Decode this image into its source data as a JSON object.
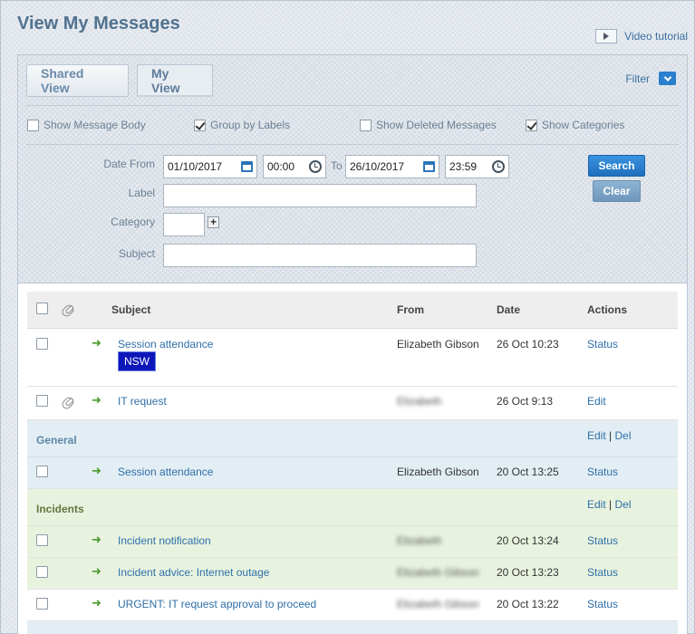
{
  "header": {
    "title": "View My Messages",
    "video_label": "Video tutorial"
  },
  "tabs": [
    {
      "label": "Shared View"
    },
    {
      "label": "My View"
    }
  ],
  "filter": {
    "label": "Filter"
  },
  "options": {
    "show_body": {
      "label": "Show Message Body",
      "checked": false
    },
    "group_labels": {
      "label": "Group by Labels",
      "checked": true
    },
    "show_deleted": {
      "label": "Show Deleted Messages",
      "checked": false
    },
    "show_categories": {
      "label": "Show Categories",
      "checked": true
    }
  },
  "form": {
    "date_from_label": "Date From",
    "date_from": "01/10/2017",
    "time_from": "00:00",
    "to_label": "To",
    "date_to": "26/10/2017",
    "time_to": "23:59",
    "label_label": "Label",
    "label_value": "",
    "category_label": "Category",
    "category_value": "",
    "subject_label": "Subject",
    "subject_value": "",
    "search_button": "Search",
    "clear_button": "Clear"
  },
  "table": {
    "columns": {
      "subject": "Subject",
      "from": "From",
      "date": "Date",
      "actions": "Actions"
    },
    "rows": [
      {
        "subject": "Session attendance",
        "from": "Elizabeth Gibson",
        "date": "26 Oct 10:23",
        "action": "Status",
        "tag": "NSW"
      },
      {
        "subject": "IT request",
        "from": "Elizabeth",
        "date": "26 Oct 9:13",
        "action": "Edit"
      }
    ],
    "groups": [
      {
        "name": "General",
        "edit": "Edit",
        "sep": "|",
        "del": "Del",
        "rows": [
          {
            "subject": "Session attendance",
            "from": "Elizabeth Gibson",
            "date": "20 Oct 13:25",
            "action": "Status"
          }
        ]
      },
      {
        "name": "Incidents",
        "edit": "Edit",
        "sep": "|",
        "del": "Del",
        "rows": [
          {
            "subject": "Incident notification",
            "from": "Elizabeth",
            "date": "20 Oct 13:24",
            "action": "Status"
          },
          {
            "subject": "Incident advice: Internet outage",
            "from": "Elizabeth Gibson",
            "date": "20 Oct 13:23",
            "action": "Status"
          },
          {
            "subject": "URGENT: IT request approval to proceed",
            "from": "Elizabeth Gibson",
            "date": "20 Oct 13:22",
            "action": "Status"
          }
        ]
      }
    ]
  },
  "colors": {
    "accent": "#2a7fcf",
    "general_bg": "#e3eef4",
    "general_text": "#5b86a8",
    "incidents_bg": "#e8f3df",
    "incidents_text": "#66753f",
    "tag_bg": "#0d16b8"
  }
}
